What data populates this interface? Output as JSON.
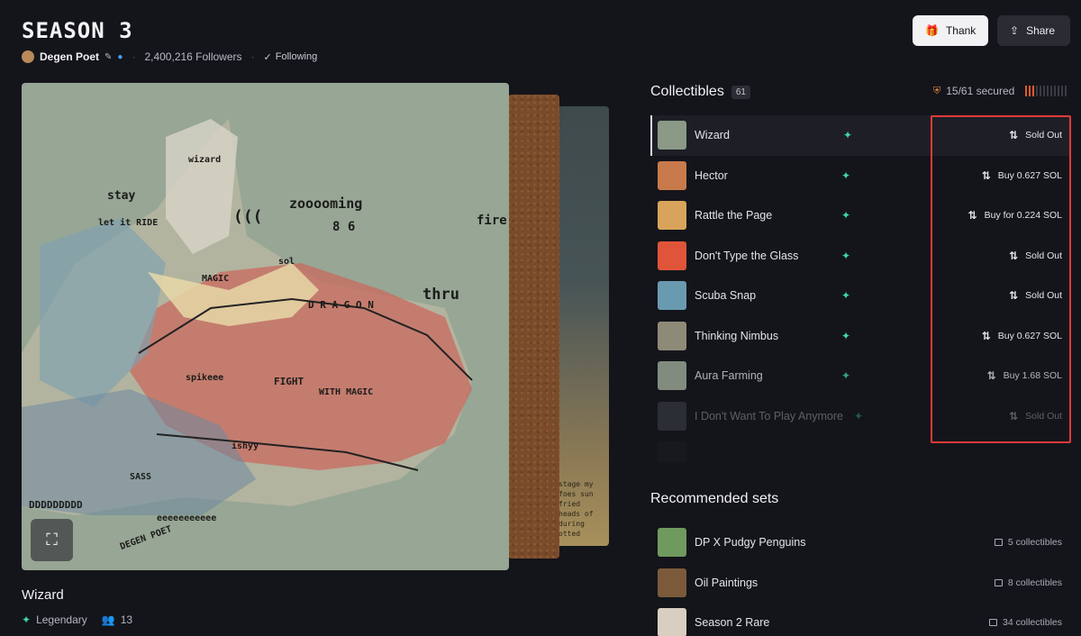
{
  "header": {
    "title": "SEASON 3",
    "author": "Degen Poet",
    "followers": "2,400,216 Followers",
    "following": "Following",
    "thank_label": "Thank",
    "share_label": "Share"
  },
  "artwork": {
    "name": "Wizard",
    "rarity": "Legendary",
    "owners": "13",
    "words": [
      "zooooming",
      "thru",
      "D R A G O N",
      "spikeee",
      "FIGHT",
      "WITH MAGIC",
      "sol",
      "MAGIC",
      "let it RIDE",
      "stay",
      "wizard",
      "fire",
      "SASS",
      "DDDDDDDDD",
      "eeeeeeeeeee",
      "ishyy",
      "((( ",
      "8 6",
      "DEGEN POET"
    ],
    "back_card_text": "stage my foes sun fried heads of during otted"
  },
  "collectibles": {
    "title": "Collectibles",
    "count": "61",
    "secured": "15/61 secured",
    "items": [
      {
        "name": "Wizard",
        "action": "Sold Out",
        "thumb": "#8a9a86"
      },
      {
        "name": "Hector",
        "action": "Buy 0.627 SOL",
        "thumb": "#c97a4a"
      },
      {
        "name": "Rattle the Page",
        "action": "Buy for 0.224 SOL",
        "thumb": "#d8a45c"
      },
      {
        "name": "Don't Type the Glass",
        "action": "Sold Out",
        "thumb": "#e0553a"
      },
      {
        "name": "Scuba Snap",
        "action": "Sold Out",
        "thumb": "#6a9ab0"
      },
      {
        "name": "Thinking Nimbus",
        "action": "Buy 0.627 SOL",
        "thumb": "#8e8a78"
      },
      {
        "name": "Aura Farming",
        "action": "Buy 1.68 SOL",
        "thumb": "#a7b4a0"
      },
      {
        "name": "I Don't Want To Play Anymore",
        "action": "Sold Out",
        "thumb": "#5a5f66"
      },
      {
        "name": "",
        "action": "",
        "thumb": "#3a3d44"
      }
    ]
  },
  "recommended": {
    "title": "Recommended sets",
    "items": [
      {
        "name": "DP X Pudgy Penguins",
        "count": "5 collectibles",
        "thumb": "#6e9a5e"
      },
      {
        "name": "Oil Paintings",
        "count": "8 collectibles",
        "thumb": "#7a5a3a"
      },
      {
        "name": "Season 2 Rare",
        "count": "34 collectibles",
        "thumb": "#d9cfc0"
      }
    ]
  },
  "colors": {
    "background": "#14151b",
    "accent_rarity": "#3fd6a8",
    "highlight": "#e03a3a",
    "secured_bar": "#e05a2a"
  }
}
